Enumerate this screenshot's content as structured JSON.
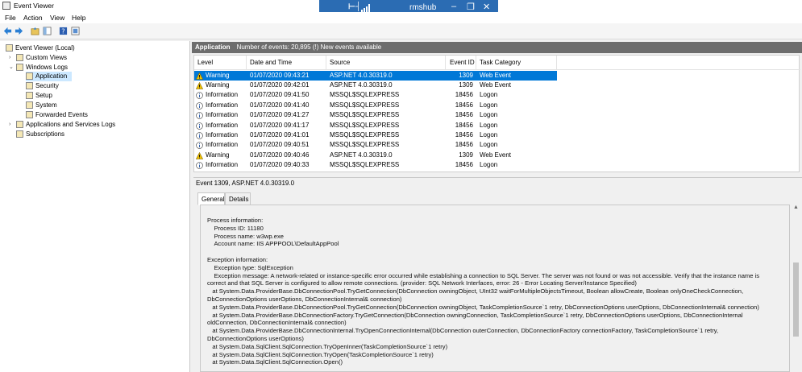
{
  "window": {
    "title": "Event Viewer"
  },
  "remote_bar": {
    "host": "rmshub",
    "pin_label": "⊢┤",
    "minimize": "–",
    "restore": "❐",
    "close": "✕"
  },
  "menu": {
    "file": "File",
    "action": "Action",
    "view": "View",
    "help": "Help"
  },
  "tree": {
    "root": "Event Viewer (Local)",
    "custom_views": "Custom Views",
    "windows_logs": "Windows Logs",
    "application": "Application",
    "security": "Security",
    "setup": "Setup",
    "system": "System",
    "forwarded": "Forwarded Events",
    "app_services": "Applications and Services Logs",
    "subscriptions": "Subscriptions"
  },
  "pane": {
    "title": "Application",
    "summary": "Number of events: 20,895 (!) New events available"
  },
  "columns": {
    "level": "Level",
    "datetime": "Date and Time",
    "source": "Source",
    "event_id": "Event ID",
    "task": "Task Category"
  },
  "events": [
    {
      "level": "Warning",
      "datetime": "01/07/2020 09:43:21",
      "source": "ASP.NET 4.0.30319.0",
      "event_id": "1309",
      "task": "Web Event"
    },
    {
      "level": "Warning",
      "datetime": "01/07/2020 09:42:01",
      "source": "ASP.NET 4.0.30319.0",
      "event_id": "1309",
      "task": "Web Event"
    },
    {
      "level": "Information",
      "datetime": "01/07/2020 09:41:50",
      "source": "MSSQL$SQLEXPRESS",
      "event_id": "18456",
      "task": "Logon"
    },
    {
      "level": "Information",
      "datetime": "01/07/2020 09:41:40",
      "source": "MSSQL$SQLEXPRESS",
      "event_id": "18456",
      "task": "Logon"
    },
    {
      "level": "Information",
      "datetime": "01/07/2020 09:41:27",
      "source": "MSSQL$SQLEXPRESS",
      "event_id": "18456",
      "task": "Logon"
    },
    {
      "level": "Information",
      "datetime": "01/07/2020 09:41:17",
      "source": "MSSQL$SQLEXPRESS",
      "event_id": "18456",
      "task": "Logon"
    },
    {
      "level": "Information",
      "datetime": "01/07/2020 09:41:01",
      "source": "MSSQL$SQLEXPRESS",
      "event_id": "18456",
      "task": "Logon"
    },
    {
      "level": "Information",
      "datetime": "01/07/2020 09:40:51",
      "source": "MSSQL$SQLEXPRESS",
      "event_id": "18456",
      "task": "Logon"
    },
    {
      "level": "Warning",
      "datetime": "01/07/2020 09:40:46",
      "source": "ASP.NET 4.0.30319.0",
      "event_id": "1309",
      "task": "Web Event"
    },
    {
      "level": "Information",
      "datetime": "01/07/2020 09:40:33",
      "source": "MSSQL$SQLEXPRESS",
      "event_id": "18456",
      "task": "Logon"
    }
  ],
  "detail": {
    "header": "Event 1309, ASP.NET 4.0.30319.0",
    "tab_general": "General",
    "tab_details": "Details",
    "text": "Process information:\n    Process ID: 11180\n    Process name: w3wp.exe\n    Account name: IIS APPPOOL\\DefaultAppPool\n\nException information:\n    Exception type: SqlException\n    Exception message: A network-related or instance-specific error occurred while establishing a connection to SQL Server. The server was not found or was not accessible. Verify that the instance name is\ncorrect and that SQL Server is configured to allow remote connections. (provider: SQL Network Interfaces, error: 26 - Error Locating Server/Instance Specified)\n   at System.Data.ProviderBase.DbConnectionPool.TryGetConnection(DbConnection owningObject, UInt32 waitForMultipleObjectsTimeout, Boolean allowCreate, Boolean onlyOneCheckConnection,\nDbConnectionOptions userOptions, DbConnectionInternal& connection)\n   at System.Data.ProviderBase.DbConnectionPool.TryGetConnection(DbConnection owningObject, TaskCompletionSource`1 retry, DbConnectionOptions userOptions, DbConnectionInternal& connection)\n   at System.Data.ProviderBase.DbConnectionFactory.TryGetConnection(DbConnection owningConnection, TaskCompletionSource`1 retry, DbConnectionOptions userOptions, DbConnectionInternal\noldConnection, DbConnectionInternal& connection)\n   at System.Data.ProviderBase.DbConnectionInternal.TryOpenConnectionInternal(DbConnection outerConnection, DbConnectionFactory connectionFactory, TaskCompletionSource`1 retry,\nDbConnectionOptions userOptions)\n   at System.Data.SqlClient.SqlConnection.TryOpenInner(TaskCompletionSource`1 retry)\n   at System.Data.SqlClient.SqlConnection.TryOpen(TaskCompletionSource`1 retry)\n   at System.Data.SqlClient.SqlConnection.Open()"
  },
  "colors": {
    "selection": "#0078d7",
    "header_bar": "#6d6d6d",
    "remote_bar": "#2b6cb3"
  }
}
